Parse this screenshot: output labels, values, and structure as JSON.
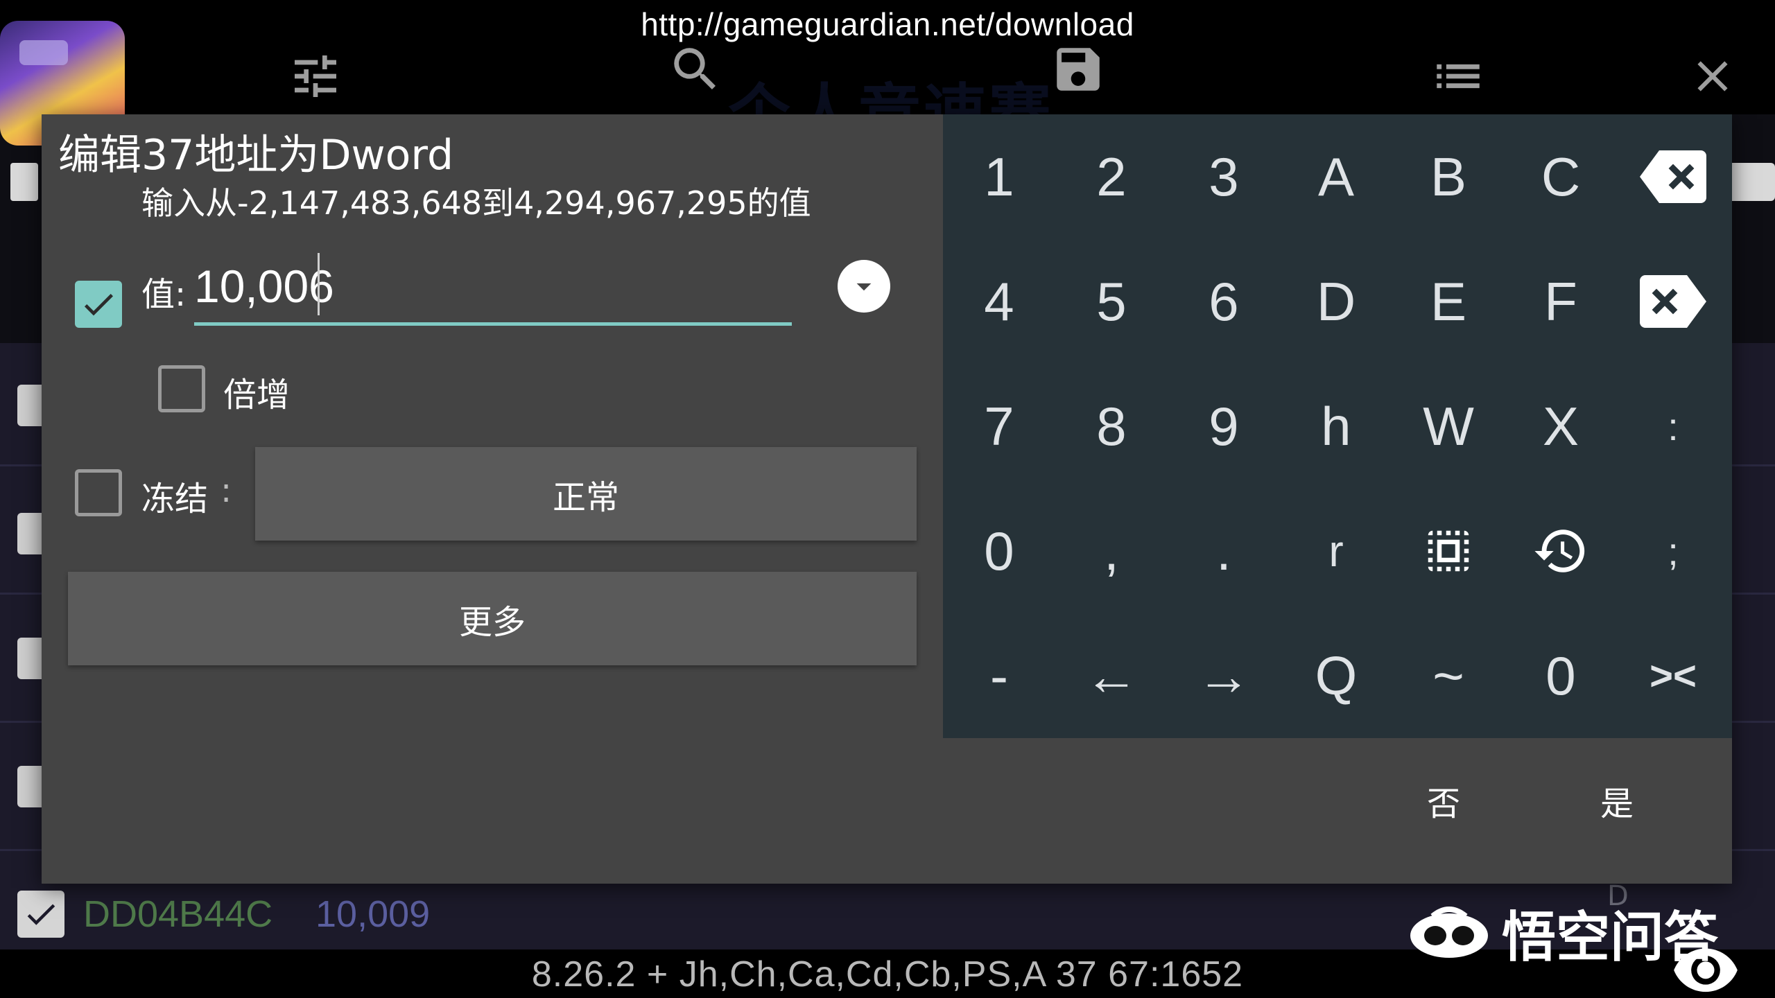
{
  "top": {
    "url": "http://gameguardian.net/download",
    "faded_title": "个人竞速赛"
  },
  "dialog": {
    "title": "编辑37地址为Dword",
    "subtitle": "输入从-2,147,483,648到4,294,967,295的值",
    "value_label": "值:",
    "value": "10,006",
    "value_checked": true,
    "multiply_label": "倍增",
    "multiply_checked": false,
    "freeze_label": "冻结",
    "freeze_colon": ":",
    "freeze_checked": false,
    "freeze_mode": "正常",
    "more_label": "更多",
    "no_label": "否",
    "yes_label": "是"
  },
  "keypad": {
    "rows": [
      [
        "1",
        "2",
        "3",
        "A",
        "B",
        "C",
        "backspace-icon"
      ],
      [
        "4",
        "5",
        "6",
        "D",
        "E",
        "F",
        "clear-icon"
      ],
      [
        "7",
        "8",
        "9",
        "h",
        "W",
        "X",
        ":"
      ],
      [
        "0",
        ",",
        ".",
        "r",
        "select-all-icon",
        "history-icon",
        ";"
      ],
      [
        "-",
        "←",
        "→",
        "Q",
        "~",
        "0",
        "><"
      ]
    ]
  },
  "background": {
    "row_address": "DD04B44C",
    "row_value": "10,009",
    "row_type": "D",
    "status": "8.26.2  +  Jh,Ch,Ca,Cd,Cb,PS,A  37  67:1652",
    "watermark": "悟空问答"
  },
  "colors": {
    "accent": "#80cbc4",
    "dialog_bg": "#444444",
    "keypad_bg": "#263238"
  }
}
